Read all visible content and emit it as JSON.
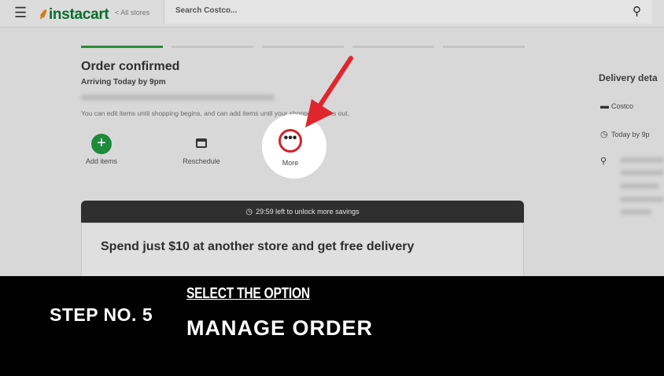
{
  "header": {
    "logo_text": "instacart",
    "all_stores": "< All stores",
    "search_placeholder": "Search Costco..."
  },
  "order": {
    "title": "Order confirmed",
    "arrival": "Arriving Today by 9pm",
    "edit_note": "You can edit items until shopping begins, and can add items until your shopper checks out."
  },
  "actions": {
    "add_items": "Add items",
    "reschedule": "Reschedule",
    "more": "More"
  },
  "promo": {
    "timer": "29:59 left to unlock more savings",
    "headline": "Spend just $10 at another store and get free delivery"
  },
  "delivery_panel": {
    "title": "Delivery deta",
    "store": "Costco",
    "time": "Today by 9p"
  },
  "overlay": {
    "step": "STEP NO. 5",
    "instruction": "SELECT THE OPTION",
    "option": "MANAGE ORDER"
  },
  "colors": {
    "brand_green": "#0a6b2d",
    "highlight_red": "#d3222a",
    "add_green": "#1e8a3c"
  }
}
